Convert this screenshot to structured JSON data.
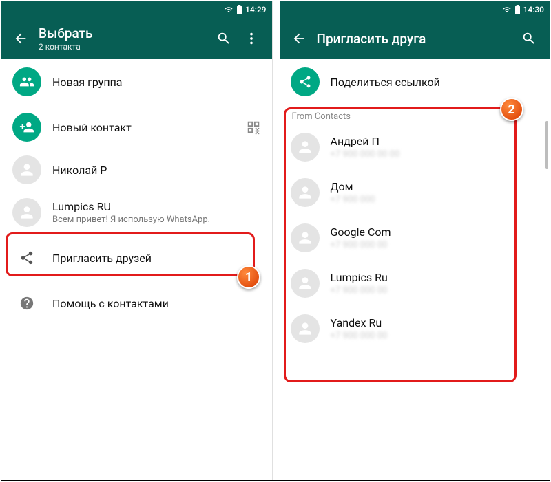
{
  "left": {
    "status": {
      "time": "14:29"
    },
    "appbar": {
      "title": "Выбрать",
      "subtitle": "2 контакта"
    },
    "rows": {
      "new_group": "Новая группа",
      "new_contact": "Новый контакт",
      "contact1": {
        "name": "Николай Р"
      },
      "contact2": {
        "name": "Lumpics RU",
        "status": "Всем привет! Я использую WhatsApp."
      },
      "invite": "Пригласить друзей",
      "help": "Помощь с контактами"
    },
    "callout": "1"
  },
  "right": {
    "status": {
      "time": "14:30"
    },
    "appbar": {
      "title": "Пригласить друга"
    },
    "share_link": "Поделиться ссылкой",
    "section": "From Contacts",
    "contacts": [
      {
        "name": "Андрей П",
        "sub": "+7 900 000 00 00"
      },
      {
        "name": "Дом",
        "sub": "+7 900 000"
      },
      {
        "name": "Google Com",
        "sub": "+7 900 000 00"
      },
      {
        "name": "Lumpics Ru",
        "sub": "+7 900 000 00"
      },
      {
        "name": "Yandex Ru",
        "sub": "+7 900 000 00"
      }
    ],
    "callout": "2"
  }
}
